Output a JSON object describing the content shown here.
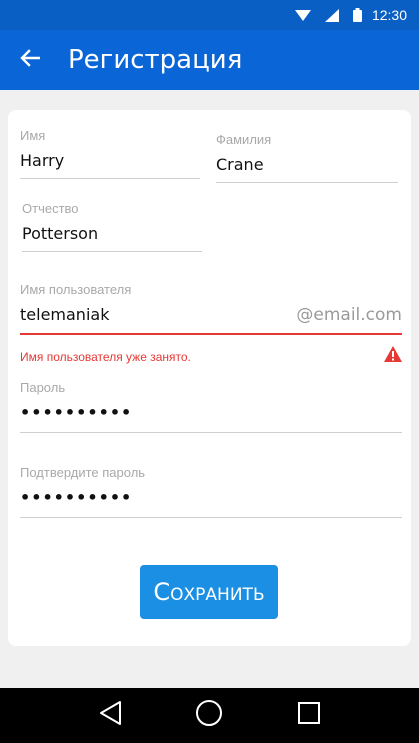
{
  "status_bar": {
    "time": "12:30"
  },
  "app_bar": {
    "title": "Регистрация"
  },
  "form": {
    "first_name": {
      "label": "Имя",
      "value": "Harry"
    },
    "last_name": {
      "label": "Фамилия",
      "value": "Crane"
    },
    "patronymic": {
      "label": "Отчество",
      "value": "Potterson"
    },
    "username": {
      "label": "Имя пользователя",
      "value": "telemaniak",
      "suffix": "@email.com",
      "error": "Имя пользователя уже занято."
    },
    "password": {
      "label": "Пароль",
      "value": "••••••••••"
    },
    "confirm_password": {
      "label": "Подтвердите пароль",
      "value": "••••••••••"
    },
    "save_label": "Сохранить"
  },
  "colors": {
    "primary": "#0a66d6",
    "status": "#0a5fc5",
    "button": "#1a8fe3",
    "error": "#e53935"
  },
  "icons": [
    "wifi-icon",
    "signal-icon",
    "battery-icon",
    "back-arrow-icon",
    "warning-icon",
    "nav-back-icon",
    "nav-home-icon",
    "nav-recents-icon"
  ]
}
